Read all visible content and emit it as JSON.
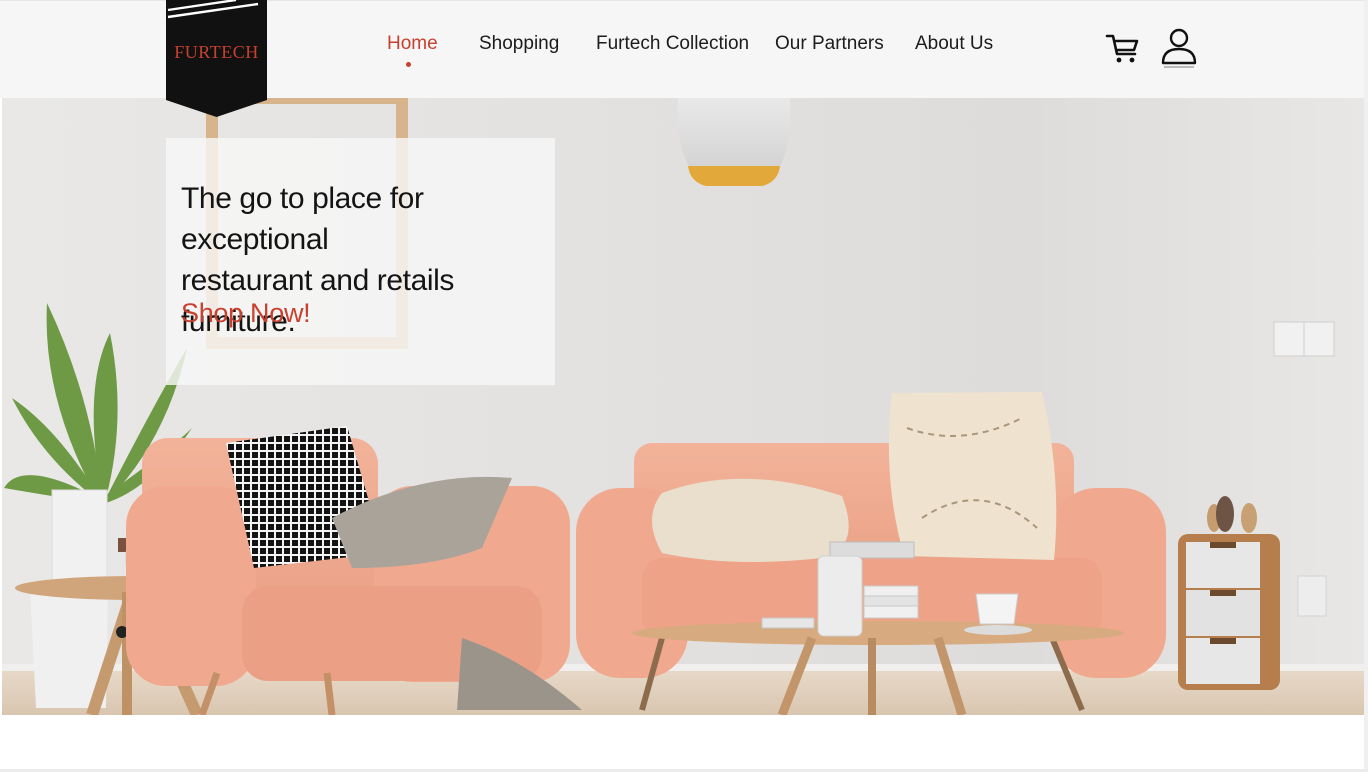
{
  "brand": {
    "name": "FURTECH"
  },
  "nav": {
    "items": [
      {
        "label": "Home",
        "active": true
      },
      {
        "label": "Shopping",
        "active": false
      },
      {
        "label": "Furtech Collection",
        "active": false
      },
      {
        "label": "Our Partners",
        "active": false
      },
      {
        "label": "About Us",
        "active": false
      }
    ]
  },
  "header_icons": {
    "cart": "shopping-cart-icon",
    "account": "user-icon"
  },
  "hero": {
    "headline_line1": "The go to place for exceptional",
    "headline_line2": "restaurant and retails furniture.",
    "cta": "Shop Now!"
  },
  "colors": {
    "accent": "#c8402f",
    "header_bg": "#f6f6f6",
    "logo_bg": "#111111"
  }
}
